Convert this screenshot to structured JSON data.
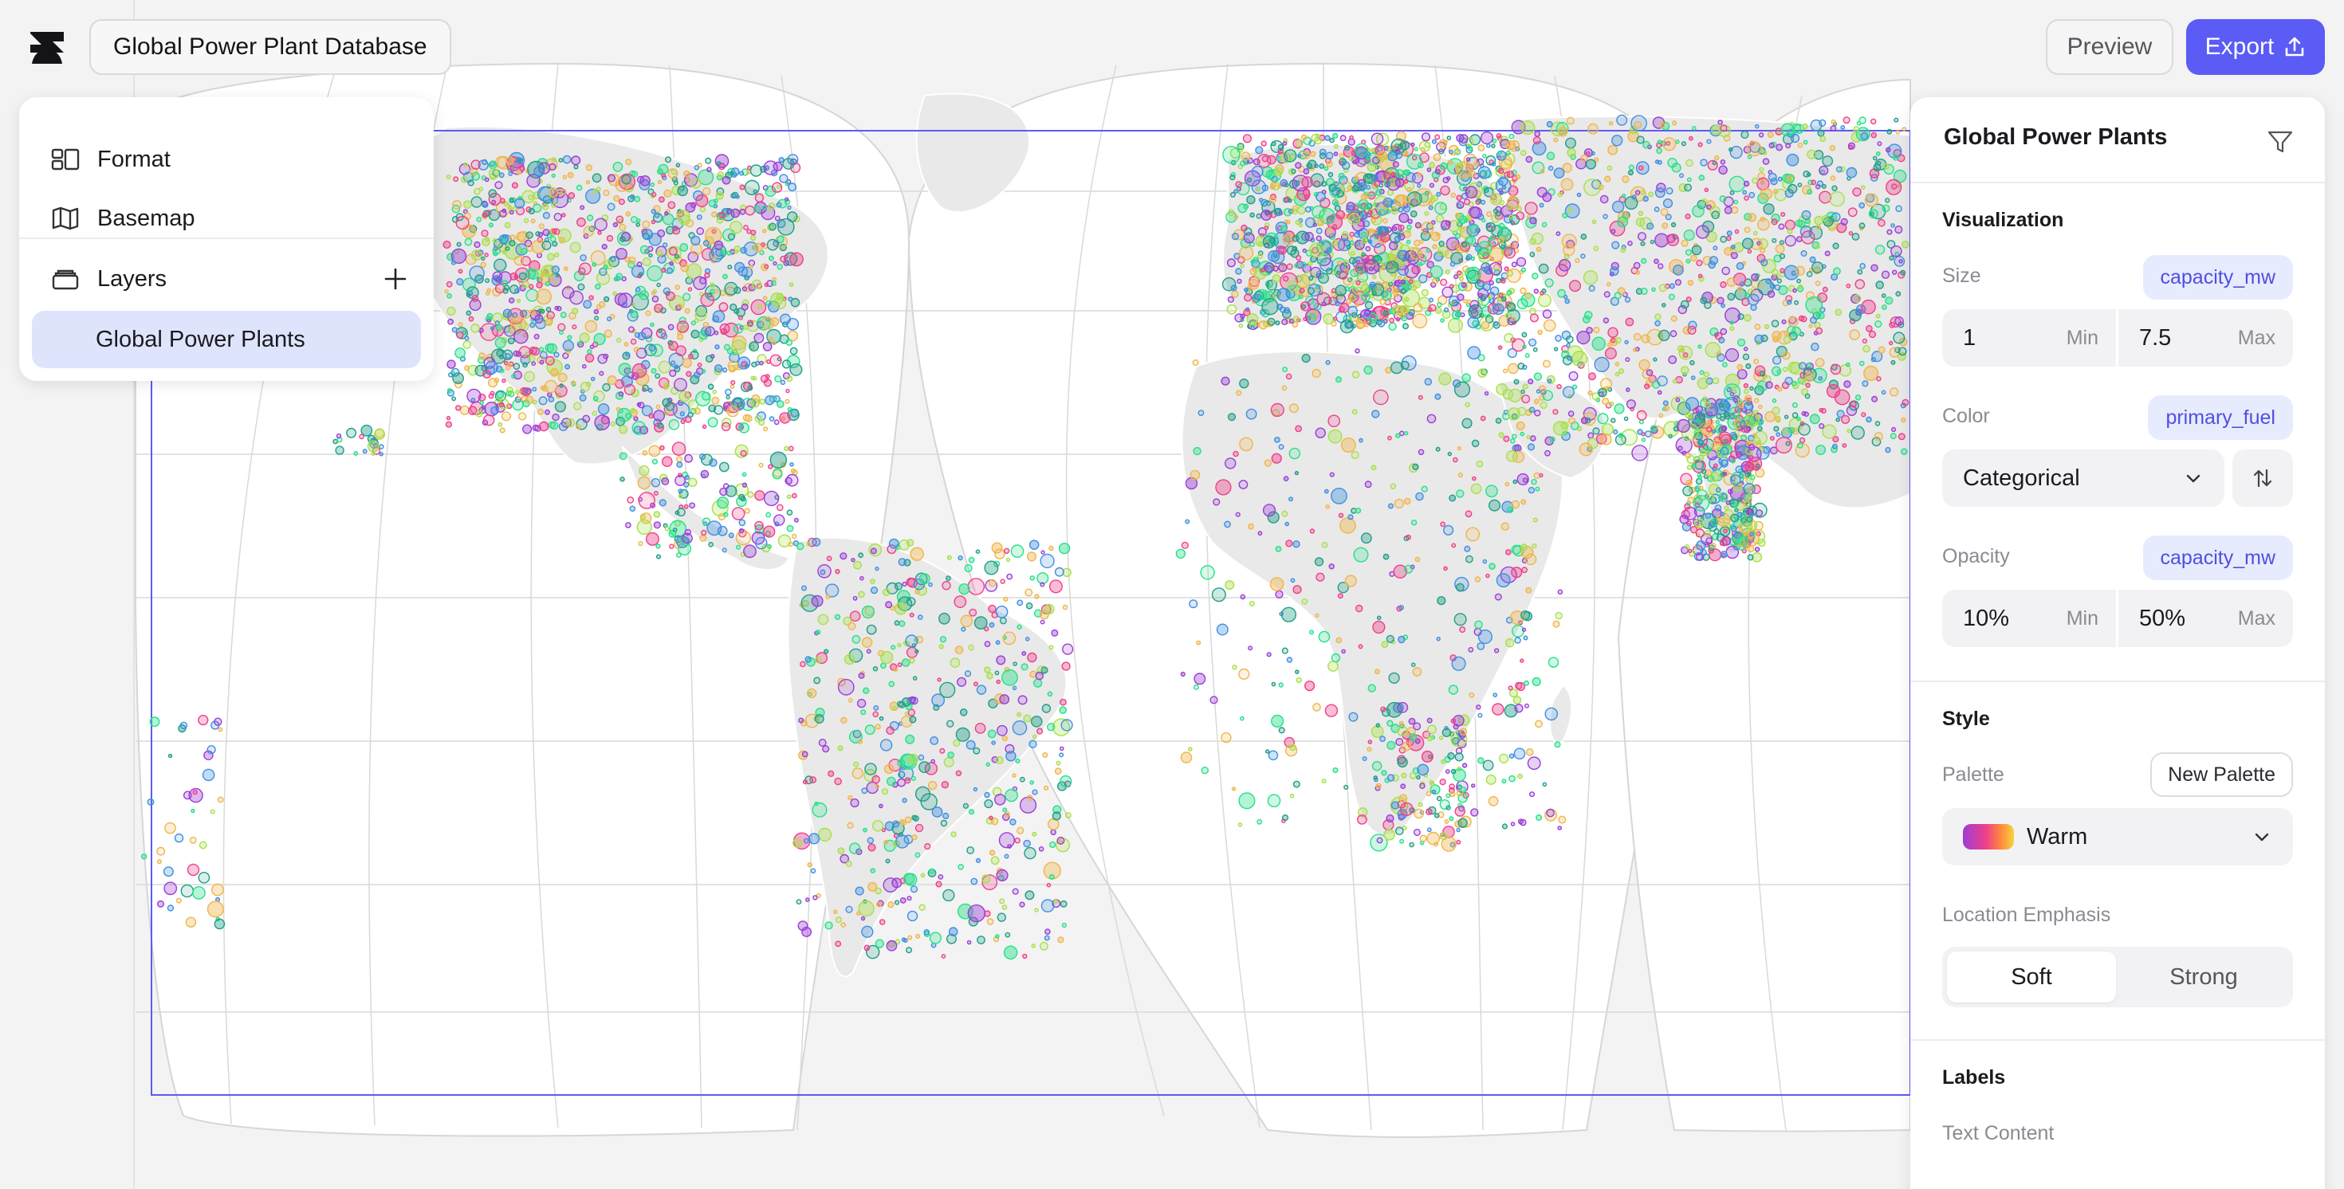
{
  "header": {
    "document_title": "Global Power Plant Database",
    "preview_label": "Preview",
    "export_label": "Export"
  },
  "left_panel": {
    "format_label": "Format",
    "basemap_label": "Basemap",
    "layers_label": "Layers",
    "layers": [
      {
        "label": "Global Power Plants",
        "selected": true
      }
    ]
  },
  "right_panel": {
    "layer_title": "Global Power Plants",
    "visualization": {
      "section_label": "Visualization",
      "size": {
        "label": "Size",
        "field": "capacity_mw",
        "min_value": "1",
        "min_label": "Min",
        "max_value": "7.5",
        "max_label": "Max"
      },
      "color": {
        "label": "Color",
        "field": "primary_fuel",
        "mode": "Categorical"
      },
      "opacity": {
        "label": "Opacity",
        "field": "capacity_mw",
        "min_value": "10%",
        "min_label": "Min",
        "max_value": "50%",
        "max_label": "Max"
      }
    },
    "style": {
      "section_label": "Style",
      "palette_label": "Palette",
      "new_palette_label": "New Palette",
      "palette_value": "Warm",
      "emphasis_label": "Location Emphasis",
      "emphasis_options": [
        "Soft",
        "Strong"
      ],
      "emphasis_selected": "Soft"
    },
    "labels": {
      "section_label": "Labels",
      "text_content_label": "Text Content"
    }
  },
  "colors": {
    "accent": "#5b5bf5",
    "chip_bg": "#e7ebfe",
    "chip_text": "#4f4fe0",
    "selected_row": "#dfe4fd",
    "fuel_palette": [
      "#27e089",
      "#ef3f8a",
      "#9b3dd6",
      "#1f9e86",
      "#f0b54a",
      "#3f8fe0",
      "#a8e04a"
    ]
  }
}
